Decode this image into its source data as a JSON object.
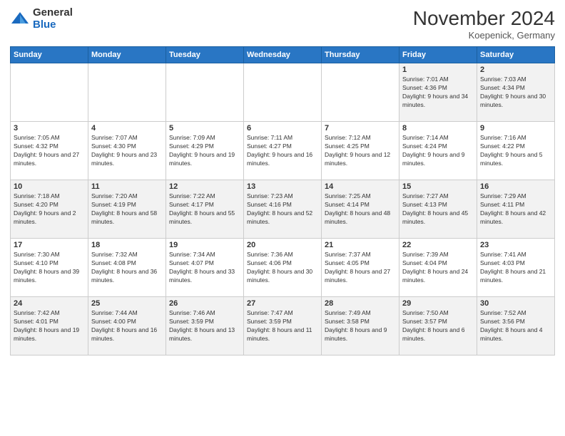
{
  "header": {
    "logo_general": "General",
    "logo_blue": "Blue",
    "title": "November 2024",
    "location": "Koepenick, Germany"
  },
  "days_of_week": [
    "Sunday",
    "Monday",
    "Tuesday",
    "Wednesday",
    "Thursday",
    "Friday",
    "Saturday"
  ],
  "weeks": [
    [
      {
        "day": "",
        "info": ""
      },
      {
        "day": "",
        "info": ""
      },
      {
        "day": "",
        "info": ""
      },
      {
        "day": "",
        "info": ""
      },
      {
        "day": "",
        "info": ""
      },
      {
        "day": "1",
        "info": "Sunrise: 7:01 AM\nSunset: 4:36 PM\nDaylight: 9 hours and 34 minutes."
      },
      {
        "day": "2",
        "info": "Sunrise: 7:03 AM\nSunset: 4:34 PM\nDaylight: 9 hours and 30 minutes."
      }
    ],
    [
      {
        "day": "3",
        "info": "Sunrise: 7:05 AM\nSunset: 4:32 PM\nDaylight: 9 hours and 27 minutes."
      },
      {
        "day": "4",
        "info": "Sunrise: 7:07 AM\nSunset: 4:30 PM\nDaylight: 9 hours and 23 minutes."
      },
      {
        "day": "5",
        "info": "Sunrise: 7:09 AM\nSunset: 4:29 PM\nDaylight: 9 hours and 19 minutes."
      },
      {
        "day": "6",
        "info": "Sunrise: 7:11 AM\nSunset: 4:27 PM\nDaylight: 9 hours and 16 minutes."
      },
      {
        "day": "7",
        "info": "Sunrise: 7:12 AM\nSunset: 4:25 PM\nDaylight: 9 hours and 12 minutes."
      },
      {
        "day": "8",
        "info": "Sunrise: 7:14 AM\nSunset: 4:24 PM\nDaylight: 9 hours and 9 minutes."
      },
      {
        "day": "9",
        "info": "Sunrise: 7:16 AM\nSunset: 4:22 PM\nDaylight: 9 hours and 5 minutes."
      }
    ],
    [
      {
        "day": "10",
        "info": "Sunrise: 7:18 AM\nSunset: 4:20 PM\nDaylight: 9 hours and 2 minutes."
      },
      {
        "day": "11",
        "info": "Sunrise: 7:20 AM\nSunset: 4:19 PM\nDaylight: 8 hours and 58 minutes."
      },
      {
        "day": "12",
        "info": "Sunrise: 7:22 AM\nSunset: 4:17 PM\nDaylight: 8 hours and 55 minutes."
      },
      {
        "day": "13",
        "info": "Sunrise: 7:23 AM\nSunset: 4:16 PM\nDaylight: 8 hours and 52 minutes."
      },
      {
        "day": "14",
        "info": "Sunrise: 7:25 AM\nSunset: 4:14 PM\nDaylight: 8 hours and 48 minutes."
      },
      {
        "day": "15",
        "info": "Sunrise: 7:27 AM\nSunset: 4:13 PM\nDaylight: 8 hours and 45 minutes."
      },
      {
        "day": "16",
        "info": "Sunrise: 7:29 AM\nSunset: 4:11 PM\nDaylight: 8 hours and 42 minutes."
      }
    ],
    [
      {
        "day": "17",
        "info": "Sunrise: 7:30 AM\nSunset: 4:10 PM\nDaylight: 8 hours and 39 minutes."
      },
      {
        "day": "18",
        "info": "Sunrise: 7:32 AM\nSunset: 4:08 PM\nDaylight: 8 hours and 36 minutes."
      },
      {
        "day": "19",
        "info": "Sunrise: 7:34 AM\nSunset: 4:07 PM\nDaylight: 8 hours and 33 minutes."
      },
      {
        "day": "20",
        "info": "Sunrise: 7:36 AM\nSunset: 4:06 PM\nDaylight: 8 hours and 30 minutes."
      },
      {
        "day": "21",
        "info": "Sunrise: 7:37 AM\nSunset: 4:05 PM\nDaylight: 8 hours and 27 minutes."
      },
      {
        "day": "22",
        "info": "Sunrise: 7:39 AM\nSunset: 4:04 PM\nDaylight: 8 hours and 24 minutes."
      },
      {
        "day": "23",
        "info": "Sunrise: 7:41 AM\nSunset: 4:03 PM\nDaylight: 8 hours and 21 minutes."
      }
    ],
    [
      {
        "day": "24",
        "info": "Sunrise: 7:42 AM\nSunset: 4:01 PM\nDaylight: 8 hours and 19 minutes."
      },
      {
        "day": "25",
        "info": "Sunrise: 7:44 AM\nSunset: 4:00 PM\nDaylight: 8 hours and 16 minutes."
      },
      {
        "day": "26",
        "info": "Sunrise: 7:46 AM\nSunset: 3:59 PM\nDaylight: 8 hours and 13 minutes."
      },
      {
        "day": "27",
        "info": "Sunrise: 7:47 AM\nSunset: 3:59 PM\nDaylight: 8 hours and 11 minutes."
      },
      {
        "day": "28",
        "info": "Sunrise: 7:49 AM\nSunset: 3:58 PM\nDaylight: 8 hours and 9 minutes."
      },
      {
        "day": "29",
        "info": "Sunrise: 7:50 AM\nSunset: 3:57 PM\nDaylight: 8 hours and 6 minutes."
      },
      {
        "day": "30",
        "info": "Sunrise: 7:52 AM\nSunset: 3:56 PM\nDaylight: 8 hours and 4 minutes."
      }
    ]
  ]
}
